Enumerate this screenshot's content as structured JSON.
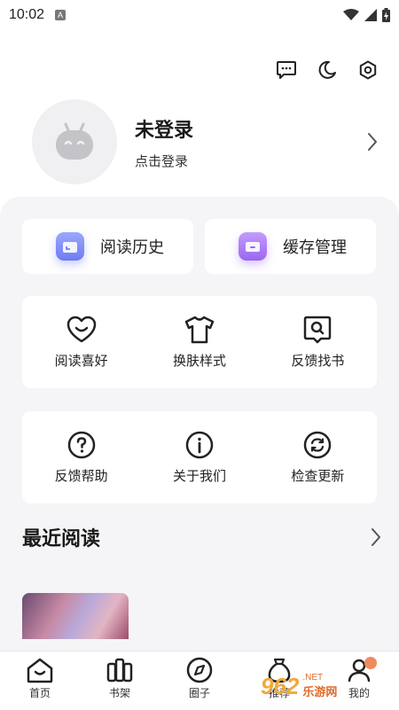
{
  "status_bar": {
    "time": "10:02",
    "app_icon_letter": "A"
  },
  "profile": {
    "name": "未登录",
    "subtitle": "点击登录"
  },
  "quick_actions": [
    {
      "label": "阅读历史",
      "icon": "calendar-icon",
      "color": "#7f8cf7"
    },
    {
      "label": "缓存管理",
      "icon": "folder-icon",
      "color": "#a77cf5"
    }
  ],
  "grid_row_1": [
    {
      "label": "阅读喜好",
      "icon": "heart-smile-icon"
    },
    {
      "label": "换肤样式",
      "icon": "tshirt-icon"
    },
    {
      "label": "反馈找书",
      "icon": "search-book-icon"
    }
  ],
  "grid_row_2": [
    {
      "label": "反馈帮助",
      "icon": "question-icon"
    },
    {
      "label": "关于我们",
      "icon": "info-icon"
    },
    {
      "label": "检查更新",
      "icon": "refresh-icon"
    }
  ],
  "recent": {
    "title": "最近阅读"
  },
  "bottom_nav": [
    {
      "label": "首页",
      "icon": "home-icon"
    },
    {
      "label": "书架",
      "icon": "bookshelf-icon"
    },
    {
      "label": "圈子",
      "icon": "compass-icon"
    },
    {
      "label": "推荐",
      "icon": "bag-icon"
    },
    {
      "label": "我的",
      "icon": "profile-icon"
    }
  ],
  "watermark": {
    "logo": "962",
    "cn": "乐游网",
    "en": ".NET"
  },
  "colors": {
    "panel_bg": "#f5f5f7",
    "accent_orange": "#f08a5d"
  }
}
